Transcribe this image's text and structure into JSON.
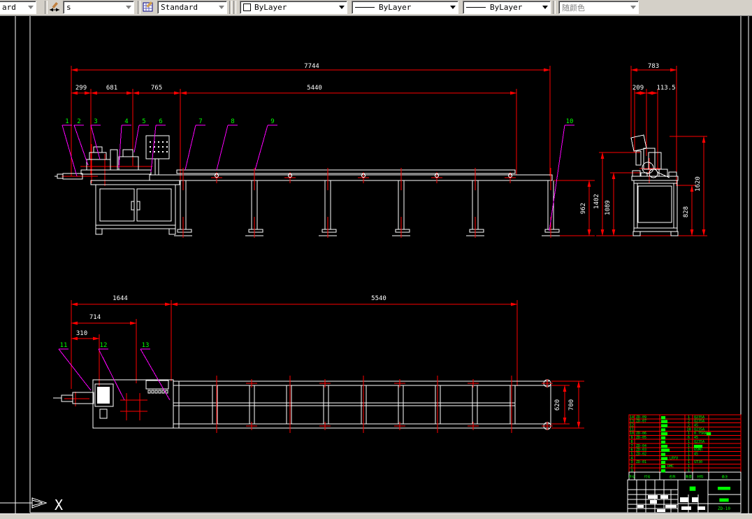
{
  "toolbar": {
    "styles_combo": "ard",
    "dimstyle_combo": "s",
    "textstyle_combo": "Standard",
    "color_combo": "ByLayer",
    "linetype_combo": "ByLayer",
    "lineweight_combo": "ByLayer",
    "plotstyle_combo": "随颜色"
  },
  "drawing": {
    "front_view": {
      "dim_overall": "7744",
      "dim_segments": [
        "299",
        "681",
        "765",
        "5440"
      ],
      "dim_height": "962"
    },
    "side_view": {
      "dim_width": "783",
      "dim_a": "209",
      "dim_b": "113.5",
      "dim_h1": "1402",
      "dim_h2": "1089",
      "dim_h3": "1620",
      "dim_h4": "828"
    },
    "plan_view": {
      "dim_left": "1644",
      "dim_right": "5540",
      "dim_a": "714",
      "dim_b": "310",
      "dim_w_inner": "620",
      "dim_w_outer": "700"
    },
    "balloons": [
      "1",
      "2",
      "3",
      "4",
      "5",
      "6",
      "7",
      "8",
      "9",
      "10",
      "11",
      "12",
      "13"
    ],
    "ucs_axis_label": "X"
  },
  "title_block": {
    "bom_headers": [
      "序号",
      "代号",
      "名称",
      "数量",
      "材料",
      "备注"
    ],
    "bom_rows": [
      [
        "14",
        "ZD-09",
        "▆▆",
        "1",
        "Q235A"
      ],
      [
        "13",
        "ZD-07",
        "▆▆▆",
        "2",
        "Q235A"
      ],
      [
        "12",
        "",
        "▆▆▆",
        "2",
        "45"
      ],
      [
        "11",
        "",
        "▆▆",
        "10",
        "Q235A"
      ],
      [
        "10",
        "ZD-06",
        "▆▆▆",
        "1",
        "0.75KW▆▆"
      ],
      [
        "9",
        "ZD-05",
        "▆▆",
        "6",
        "45"
      ],
      [
        "8",
        "",
        "▆▆",
        "1",
        "Q235A"
      ],
      [
        "7",
        "ZD-04",
        "▆▆▆",
        "1",
        "▆▆▆▆"
      ],
      [
        "6",
        "ZD-03",
        "▆▆▆▆",
        "1",
        "65Mn"
      ],
      [
        "5",
        "ZD-02",
        "▆▆",
        "1",
        "45"
      ],
      [
        "4",
        "",
        "▆▆▆ LRYV",
        "1",
        ""
      ],
      [
        "3",
        "ZD-01",
        "▆▆",
        "1",
        "ST30"
      ],
      [
        "2",
        "",
        "▆▆ DMC",
        "1",
        ""
      ],
      [
        "1",
        "",
        "▆▆",
        "1",
        ""
      ]
    ],
    "name_cell": "▆▆",
    "company_cell": "▆▆▆▆▆▆",
    "title_cell": "▆▆▆▆",
    "number_cell": "ZD-10"
  },
  "colors": {
    "dimension": "#ff0000",
    "geometry": "#ffffff",
    "balloon_text": "#00ff00",
    "leader": "#ff00ff",
    "toolbar_bg": "#d4d0c8",
    "canvas_bg": "#000000"
  }
}
